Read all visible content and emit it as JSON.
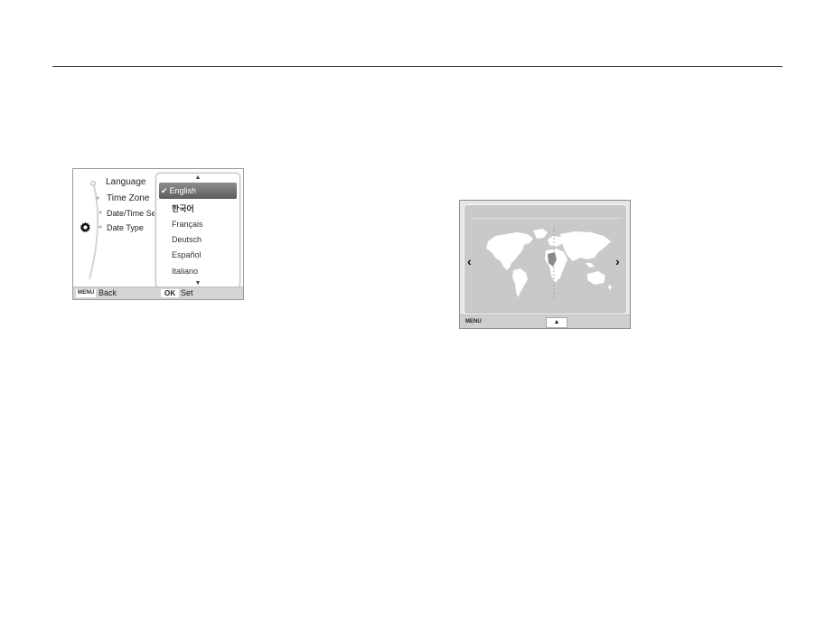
{
  "screen_language": {
    "menu": {
      "items": [
        "Language",
        "Time Zone",
        "Date/Time Set",
        "Date Type"
      ]
    },
    "dropdown": {
      "options": [
        {
          "label": "English",
          "selected": true
        },
        {
          "label": "한국어",
          "selected": false
        },
        {
          "label": "Français",
          "selected": false
        },
        {
          "label": "Deutsch",
          "selected": false
        },
        {
          "label": "Español",
          "selected": false
        },
        {
          "label": "Italiano",
          "selected": false
        }
      ],
      "check_glyph": "✔"
    },
    "footer": {
      "menu_key": "MENU",
      "back_label": "Back",
      "ok_key": "OK",
      "set_label": "Set"
    },
    "icons": {
      "settings": "gear-icon",
      "scroll_up": "chevron-up-icon",
      "scroll_down": "chevron-down-icon"
    }
  },
  "screen_world_map": {
    "footer": {
      "menu_key": "MENU",
      "up_key": "▲"
    },
    "nav": {
      "left": "‹",
      "right": "›"
    },
    "colors": {
      "land": "#ffffff",
      "ocean": "#c9c9c9",
      "highlight": "#8a8a8a"
    }
  }
}
